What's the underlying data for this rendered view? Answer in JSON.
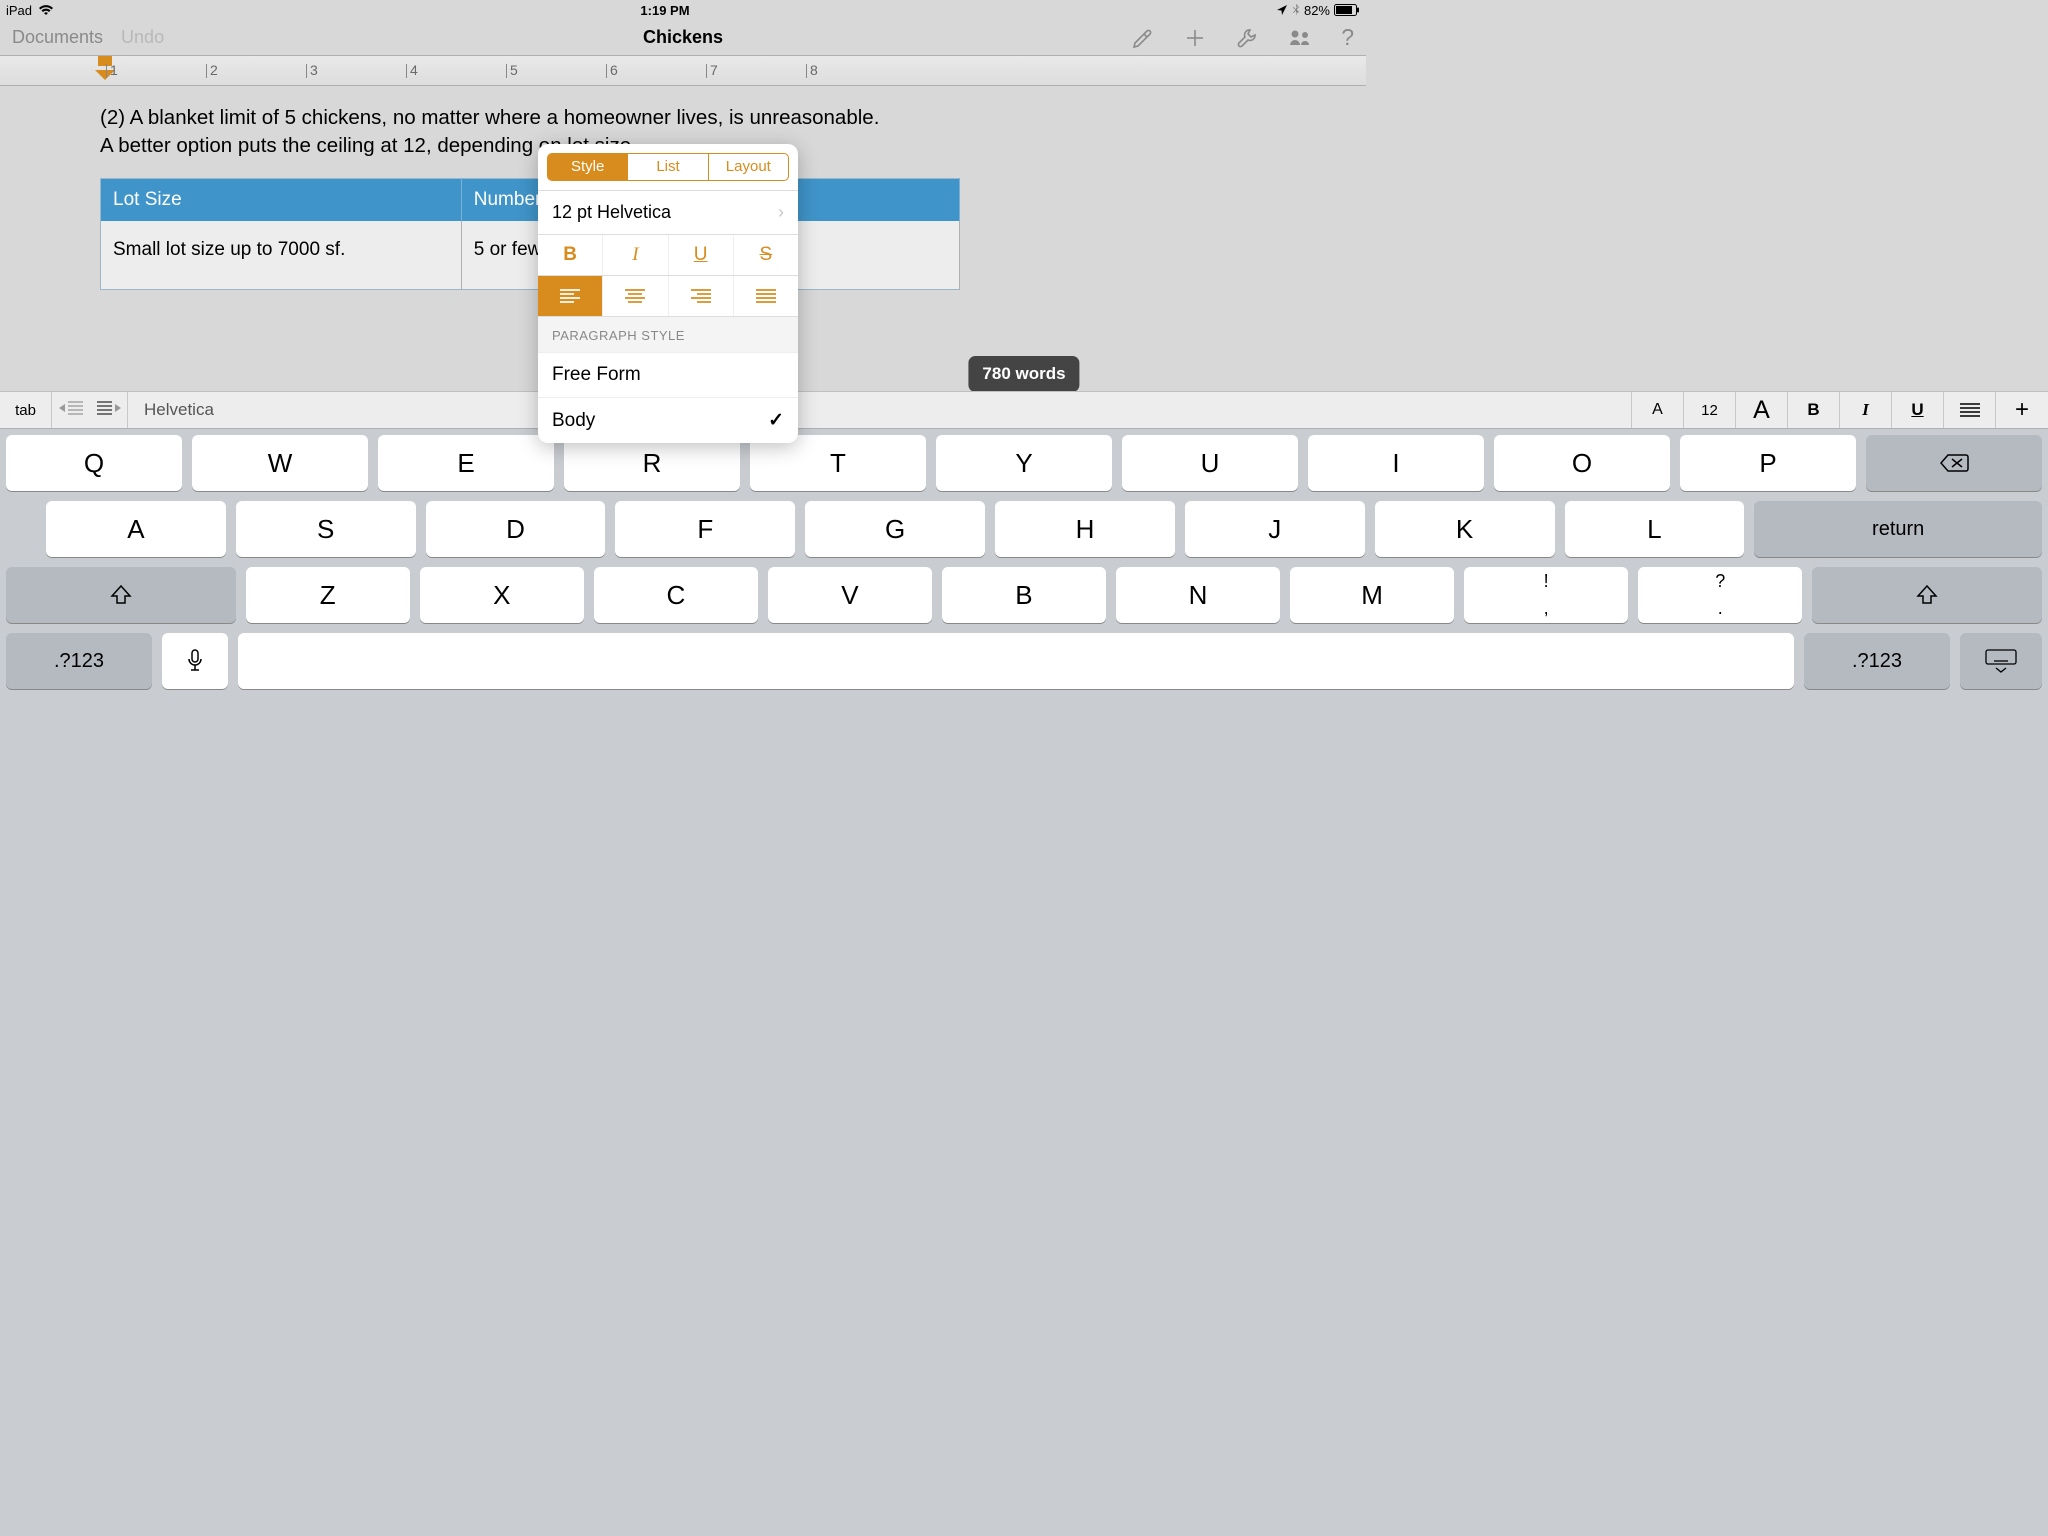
{
  "status": {
    "device": "iPad",
    "time": "1:19 PM",
    "battery": "82%"
  },
  "toolbar": {
    "documents": "Documents",
    "undo": "Undo",
    "title": "Chickens"
  },
  "ruler": {
    "ticks": [
      "1",
      "2",
      "3",
      "4",
      "5",
      "6",
      "7",
      "8"
    ]
  },
  "document": {
    "para1": "(2) A blanket limit of 5 chickens, no matter where a homeowner lives, is unreasonable.",
    "para2": "A better option puts the ceiling at 12, depending on lot size.",
    "table": {
      "headers": [
        "Lot Size",
        "Number of Chickens"
      ],
      "rows": [
        [
          "Small lot size up to 7000 sf.",
          "5 or fewer"
        ]
      ]
    },
    "word_count": "780 words"
  },
  "popover": {
    "tabs": [
      "Style",
      "List",
      "Layout"
    ],
    "font": "12 pt Helvetica",
    "section_label": "PARAGRAPH STYLE",
    "styles": [
      "Free Form",
      "Body"
    ]
  },
  "shortcut": {
    "tab": "tab",
    "fontname": "Helvetica",
    "small": "A",
    "size": "12",
    "big": "A",
    "b": "B",
    "i": "I",
    "u": "U"
  },
  "keyboard": {
    "row1": [
      "Q",
      "W",
      "E",
      "R",
      "T",
      "Y",
      "U",
      "I",
      "O",
      "P"
    ],
    "row2": [
      "A",
      "S",
      "D",
      "F",
      "G",
      "H",
      "J",
      "K",
      "L"
    ],
    "return": "return",
    "row3": [
      "Z",
      "X",
      "C",
      "V",
      "B",
      "N",
      "M"
    ],
    "spec1_top": "!",
    "spec1_bot": ",",
    "spec2_top": "?",
    "spec2_bot": ".",
    "num": ".?123"
  }
}
